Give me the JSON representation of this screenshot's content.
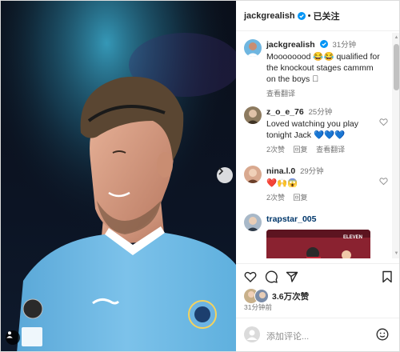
{
  "colors": {
    "verified": "#0095f6",
    "accent_blue": "#0095f6",
    "heart_red": "#ed4956"
  },
  "post": {
    "author": "jackgrealish",
    "follow_status": "已关注",
    "caption": {
      "username": "jackgrealish",
      "time": "31分钟",
      "text": "Moooooood 😂😂 qualified for the knockout stages cammm on the boys ⃞",
      "translate": "查看翻译"
    },
    "likes": "3.6万次赞",
    "time_ago": "31分钟前",
    "add_comment_placeholder": "添加评论..."
  },
  "comments": [
    {
      "username": "z_o_e_76",
      "time": "25分钟",
      "text": "Loved watching you play tonight Jack 💙💙💙",
      "likes": "2次赞",
      "reply": "回复",
      "translate": "查看翻译"
    },
    {
      "username": "nina.l.0",
      "time": "29分钟",
      "text": "❤️🙌😱",
      "likes": "2次赞",
      "reply": "回复"
    },
    {
      "username": "trapstar_005",
      "preview_caption": "ELEVEN"
    }
  ],
  "icons": {
    "verified": "verified-badge-icon",
    "next": "chevron-right-icon",
    "tag": "user-tag-icon",
    "like": "heart-icon",
    "comment": "comment-icon",
    "share": "share-icon",
    "save": "bookmark-icon",
    "emoji": "smiley-icon"
  }
}
